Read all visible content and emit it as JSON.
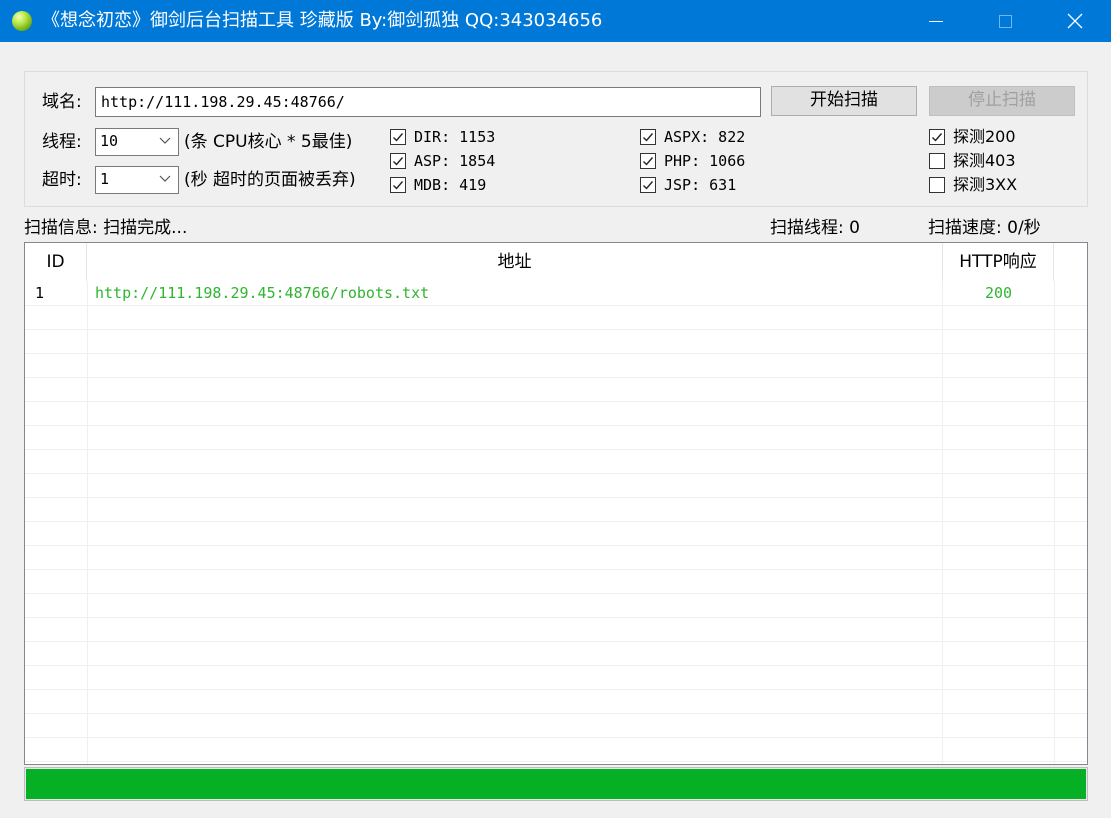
{
  "window": {
    "title": "《想念初恋》御剑后台扫描工具 珍藏版 By:御剑孤独 QQ:343034656"
  },
  "form": {
    "domain_label": "域名:",
    "domain_value": "http://111.198.29.45:48766/",
    "start_button": "开始扫描",
    "stop_button": "停止扫描",
    "threads_label": "线程:",
    "threads_value": "10",
    "threads_hint": "(条 CPU核心 * 5最佳)",
    "timeout_label": "超时:",
    "timeout_value": "1",
    "timeout_hint": "(秒 超时的页面被丢弃)"
  },
  "dictionaries": [
    {
      "label": "DIR: 1153",
      "checked": true
    },
    {
      "label": "ASP: 1854",
      "checked": true
    },
    {
      "label": "MDB: 419",
      "checked": true
    },
    {
      "label": "ASPX: 822",
      "checked": true
    },
    {
      "label": "PHP: 1066",
      "checked": true
    },
    {
      "label": "JSP: 631",
      "checked": true
    }
  ],
  "probes": [
    {
      "label": "探测200",
      "checked": true
    },
    {
      "label": "探测403",
      "checked": false
    },
    {
      "label": "探测3XX",
      "checked": false
    }
  ],
  "status": {
    "info": "扫描信息: 扫描完成...",
    "threads": "扫描线程: 0",
    "speed": "扫描速度: 0/秒"
  },
  "table": {
    "columns": [
      "ID",
      "地址",
      "HTTP响应"
    ],
    "rows": [
      {
        "id": "1",
        "url": "http://111.198.29.45:48766/robots.txt",
        "code": "200"
      }
    ]
  },
  "progress": {
    "value": 1.0
  },
  "colors": {
    "titlebar": "#0078d7",
    "result_text": "#2fb52f",
    "progress_fill": "#06b025"
  }
}
